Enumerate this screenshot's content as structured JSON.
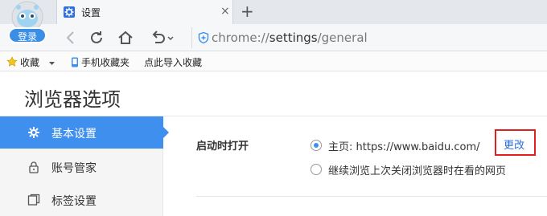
{
  "tab": {
    "title": "设置",
    "close": "×",
    "new_tab": "+"
  },
  "user": {
    "login_label": "登录"
  },
  "address": {
    "scheme": "chrome://",
    "host": "settings",
    "path": "/general"
  },
  "bookmarks": [
    {
      "label": "收藏",
      "icon": "star-icon"
    },
    {
      "label": "手机收藏夹",
      "icon": "phone-icon"
    },
    {
      "label": "点此导入收藏",
      "icon": "none"
    }
  ],
  "page": {
    "title": "浏览器选项"
  },
  "sidebar": {
    "items": [
      {
        "label": "基本设置",
        "icon": "gear-icon",
        "active": true
      },
      {
        "label": "账号管家",
        "icon": "lock-icon",
        "active": false
      },
      {
        "label": "标签设置",
        "icon": "tabs-icon",
        "active": false
      }
    ]
  },
  "startup": {
    "label": "启动时打开",
    "option_home": "主页: https://www.baidu.com/",
    "option_continue": "继续浏览上次关闭浏览器时在看的网页",
    "change_link": "更改"
  },
  "colors": {
    "accent": "#3e8fee",
    "highlight_box": "#e02020"
  }
}
